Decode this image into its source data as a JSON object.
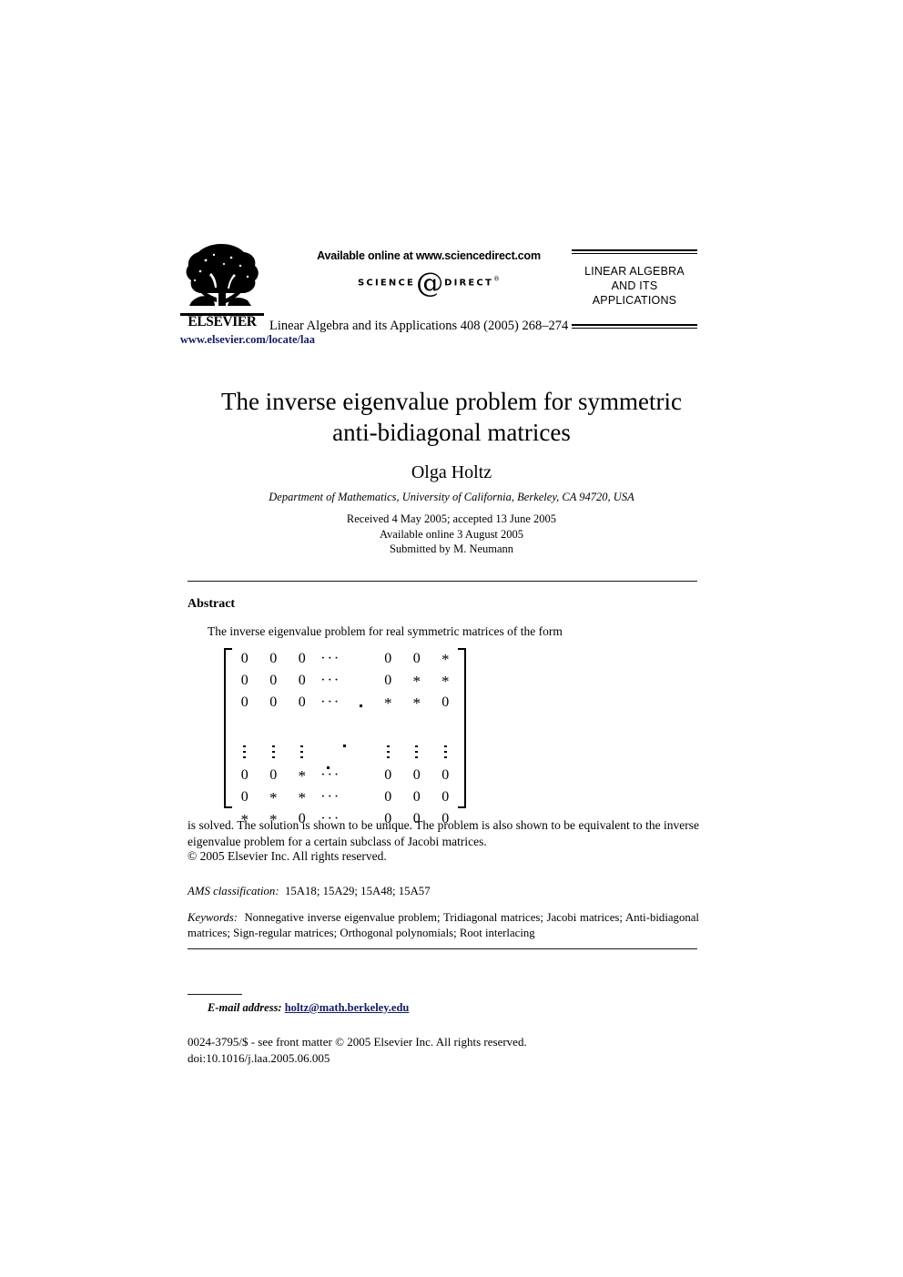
{
  "masthead": {
    "publisher_name": "ELSEVIER",
    "publisher_logo_alt": "elsevier-tree-logo",
    "available_online": "Available online at www.sciencedirect.com",
    "sciencedirect_left": "SCIENCE",
    "sciencedirect_at": "@",
    "sciencedirect_right": "DIRECT",
    "sciencedirect_reg": "®",
    "citation": "Linear Algebra and its Applications 408 (2005) 268–274",
    "journal_title_line1": "LINEAR ALGEBRA",
    "journal_title_line2": "AND ITS",
    "journal_title_line3": "APPLICATIONS",
    "journal_url": "www.elsevier.com/locate/laa",
    "link_color": "#131c63"
  },
  "article": {
    "title_line1": "The inverse eigenvalue problem for symmetric",
    "title_line2": "anti-bidiagonal matrices",
    "author": "Olga Holtz",
    "affiliation": "Department of Mathematics, University of California, Berkeley, CA 94720, USA",
    "received": "Received 4 May 2005; accepted 13 June 2005",
    "available_online": "Available online 3 August 2005",
    "submitted_by": "Submitted by M. Neumann"
  },
  "abstract": {
    "heading": "Abstract",
    "intro": "The inverse eigenvalue problem for real symmetric matrices of the form",
    "body": "is solved. The solution is shown to be unique. The problem is also shown to be equivalent to the inverse eigenvalue problem for a certain subclass of Jacobi matrices.",
    "copyright": "© 2005 Elsevier Inc. All rights reserved."
  },
  "matrix": {
    "rows": [
      [
        "0",
        "0",
        "0",
        "···",
        "",
        "0",
        "0",
        "*"
      ],
      [
        "0",
        "0",
        "0",
        "···",
        "",
        "0",
        "*",
        "*"
      ],
      [
        "0",
        "0",
        "0",
        "···",
        "",
        "*",
        "*",
        "0"
      ],
      [
        "",
        "",
        "",
        "",
        "",
        "",
        "",
        ""
      ],
      [
        "⋮",
        "⋮",
        "⋮",
        "",
        "",
        "⋮",
        "⋮",
        "⋮"
      ],
      [
        "0",
        "0",
        "*",
        "···",
        "",
        "0",
        "0",
        "0"
      ],
      [
        "0",
        "*",
        "*",
        "···",
        "",
        "0",
        "0",
        "0"
      ],
      [
        "*",
        "*",
        "0",
        "···",
        "",
        "0",
        "0",
        "0"
      ]
    ]
  },
  "classification": {
    "ams_label": "AMS classification:",
    "ams_codes": "15A18; 15A29; 15A48; 15A57",
    "keywords_label": "Keywords:",
    "keywords_text": "Nonnegative inverse eigenvalue problem; Tridiagonal matrices; Jacobi matrices; Anti-bidiagonal matrices; Sign-regular matrices; Orthogonal polynomials; Root interlacing"
  },
  "footer": {
    "email_label": "E-mail address:",
    "email": "holtz@math.berkeley.edu",
    "issn_line": "0024-3795/$ - see front matter © 2005 Elsevier Inc. All rights reserved.",
    "doi_line": "doi:10.1016/j.laa.2005.06.005"
  }
}
